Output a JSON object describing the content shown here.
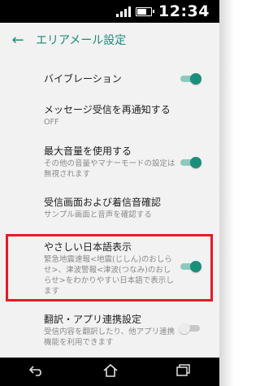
{
  "status": {
    "time": "12:34"
  },
  "appbar": {
    "title": "エリアメール設定",
    "back_icon": "arrow-left-icon"
  },
  "items": [
    {
      "title": "バイブレーション",
      "summary": "",
      "switch": "on"
    },
    {
      "title": "メッセージ受信を再通知する",
      "summary": "OFF",
      "switch": "none"
    },
    {
      "title": "最大音量を使用する",
      "summary": "その他の音量やマナーモードの設定は無視されます",
      "switch": "on"
    },
    {
      "title": "受信画面および着信音確認",
      "summary": "サンプル画面と音声を確認する",
      "switch": "none"
    },
    {
      "title": "やさしい日本語表示",
      "summary": "緊急地震速報<地震(じしん)のおしらせ>、津波警報<津波(つなみ)のおしらせ>をわかりやすい日本語で表示します",
      "switch": "on"
    },
    {
      "title": "翻訳・アプリ連携設定",
      "summary": "受信内容を翻訳したり、他アプリ連携機能を利用できます",
      "switch": "off"
    }
  ],
  "colors": {
    "accent": "#19907c",
    "highlight": "#e51c23"
  },
  "navbar": {
    "back_icon": "nav-back-icon",
    "home_icon": "home-icon",
    "recents_icon": "recents-icon"
  }
}
